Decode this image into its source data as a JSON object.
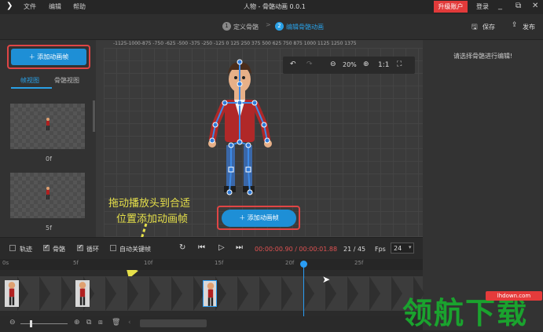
{
  "titlebar": {
    "menu": [
      "文件",
      "编辑",
      "帮助"
    ],
    "title": "人物 - 骨骼动画 0.0.1",
    "upgrade_label": "升级账户",
    "login_label": "登录",
    "window_buttons": [
      "minimize-icon",
      "restore-icon",
      "close-icon"
    ]
  },
  "steps": {
    "step1_num": "1",
    "step1_label": "定义骨骼",
    "separator": ">",
    "step2_num": "2",
    "step2_label": "编辑骨骼动画",
    "save_label": "保存",
    "publish_label": "发布"
  },
  "left_panel": {
    "add_button_label": "添加动画帧",
    "tabs": [
      "帧视图",
      "骨骼视图"
    ],
    "frames": [
      {
        "label": "0f"
      },
      {
        "label": "5f"
      }
    ]
  },
  "ruler": {
    "h_ticks": "-1125-1000-875 -750 -625 -500 -375 -250 -125  0   125  250  375  500  625  750  875  1000 1125 1250 1375"
  },
  "canvas": {
    "zoom": "20%",
    "ratio_label": "1:1",
    "hint_line1": "拖动播放头到合适",
    "hint_line2": "位置添加动画帧",
    "add_button_label": "添加动画帧"
  },
  "right_panel": {
    "hint": "请选择骨骼进行编辑!"
  },
  "playbar": {
    "options": [
      {
        "label": "轨迹",
        "checked": false
      },
      {
        "label": "骨骼",
        "checked": true
      },
      {
        "label": "循环",
        "checked": true
      },
      {
        "label": "自动关键帧",
        "checked": false
      }
    ],
    "timecode": "00:00:00.90 / 00:00:01.88",
    "frame_info": "21 / 45",
    "fps_label": "Fps",
    "fps_value": "24"
  },
  "timeline": {
    "ticks": [
      "0s",
      "5f",
      "10f",
      "15f",
      "20f",
      "25f"
    ],
    "keyframe_frames": [
      0,
      5,
      14
    ],
    "playhead_frame": 21
  },
  "watermark": {
    "text": "领航下载",
    "url": "lhdown.com"
  }
}
